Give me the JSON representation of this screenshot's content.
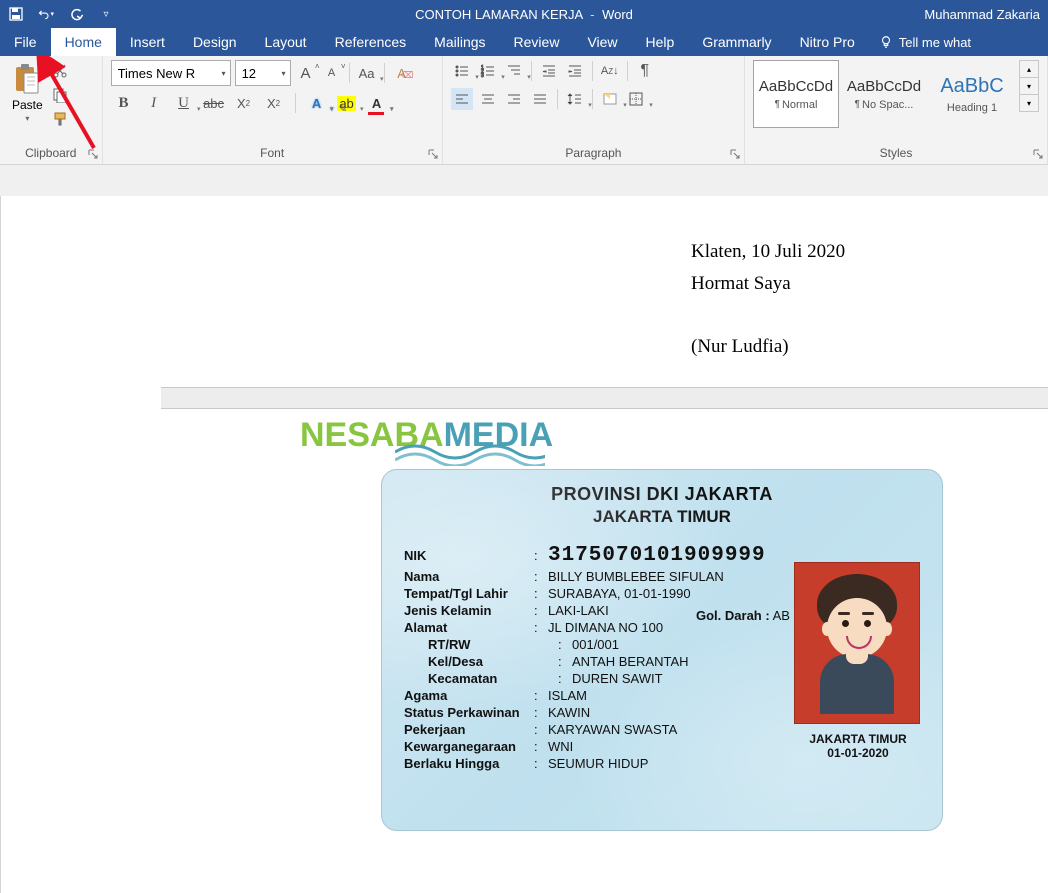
{
  "titlebar": {
    "doc_name": "CONTOH LAMARAN KERJA",
    "app": "Word",
    "user": "Muhammad Zakaria"
  },
  "tabs": {
    "file": "File",
    "home": "Home",
    "insert": "Insert",
    "design": "Design",
    "layout": "Layout",
    "references": "References",
    "mailings": "Mailings",
    "review": "Review",
    "view": "View",
    "help": "Help",
    "grammarly": "Grammarly",
    "nitro": "Nitro Pro",
    "tell_me": "Tell me what"
  },
  "ribbon": {
    "clipboard": {
      "label": "Clipboard",
      "paste": "Paste"
    },
    "font": {
      "label": "Font",
      "name": "Times New R",
      "size": "12"
    },
    "paragraph": {
      "label": "Paragraph"
    },
    "styles": {
      "label": "Styles",
      "items": [
        {
          "preview": "AaBbCcDd",
          "name": "Normal"
        },
        {
          "preview": "AaBbCcDd",
          "name": "No Spac..."
        },
        {
          "preview": "AaBbC",
          "name": "Heading 1"
        }
      ]
    }
  },
  "watermark": {
    "p1": "NESABA",
    "p2": "MEDIA"
  },
  "page1": {
    "date_place": "Klaten, 10 Juli 2020",
    "salute": "Hormat Saya",
    "signer": "(Nur Ludfia)"
  },
  "ktp": {
    "prov": "PROVINSI DKI JAKARTA",
    "kota": "JAKARTA TIMUR",
    "nik_lbl": "NIK",
    "nik": "3175070101909999",
    "nama_lbl": "Nama",
    "nama": "BILLY BUMBLEBEE SIFULAN",
    "ttl_lbl": "Tempat/Tgl Lahir",
    "ttl": "SURABAYA, 01-01-1990",
    "jk_lbl": "Jenis Kelamin",
    "jk": "LAKI-LAKI",
    "gol_lbl": "Gol. Darah :",
    "gol": "AB",
    "alamat_lbl": "Alamat",
    "alamat": "JL DIMANA NO 100",
    "rtrw_lbl": "RT/RW",
    "rtrw": "001/001",
    "keldesa_lbl": "Kel/Desa",
    "keldesa": "ANTAH BERANTAH",
    "kec_lbl": "Kecamatan",
    "kec": "DUREN SAWIT",
    "agama_lbl": "Agama",
    "agama": "ISLAM",
    "status_lbl": "Status Perkawinan",
    "status": "KAWIN",
    "kerja_lbl": "Pekerjaan",
    "kerja": "KARYAWAN SWASTA",
    "warga_lbl": "Kewarganegaraan",
    "warga": "WNI",
    "berlaku_lbl": "Berlaku Hingga",
    "berlaku": "SEUMUR HIDUP",
    "sign_place": "JAKARTA TIMUR",
    "sign_date": "01-01-2020"
  }
}
